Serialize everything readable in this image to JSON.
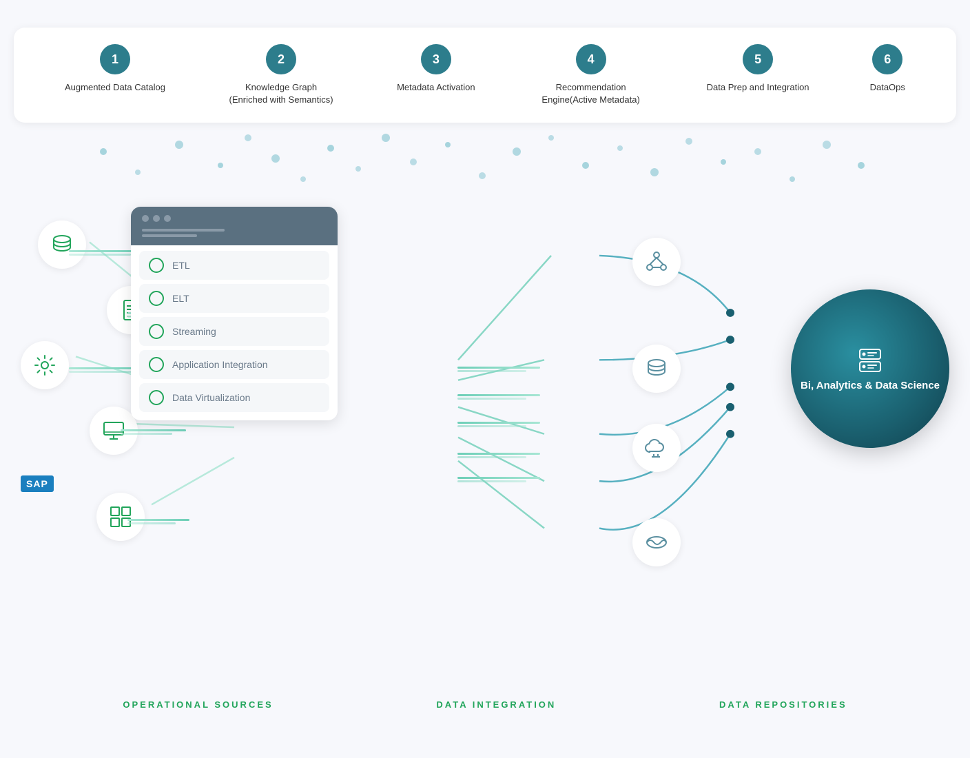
{
  "steps": [
    {
      "number": "1",
      "label": "Augmented Data Catalog"
    },
    {
      "number": "2",
      "label": "Knowledge Graph (Enriched with Semantics)"
    },
    {
      "number": "3",
      "label": "Metadata Activation"
    },
    {
      "number": "4",
      "label": "Recommendation Engine(Active Metadata)"
    },
    {
      "number": "5",
      "label": "Data Prep and Integration"
    },
    {
      "number": "6",
      "label": "DataOps"
    }
  ],
  "integration_items": [
    {
      "label": "ETL"
    },
    {
      "label": "ELT"
    },
    {
      "label": "Streaming"
    },
    {
      "label": "Application Integration"
    },
    {
      "label": "Data Virtualization"
    }
  ],
  "bi_label": "Bi, Analytics & Data Science",
  "bottom_labels": {
    "operational": "OPERATIONAL SOURCES",
    "data_integration": "DATA INTEGRATION",
    "data_repos": "DATA REPOSITORIES"
  },
  "colors": {
    "teal": "#2d8c9e",
    "green": "#22a55b",
    "bi_circle": "#1a6070"
  }
}
